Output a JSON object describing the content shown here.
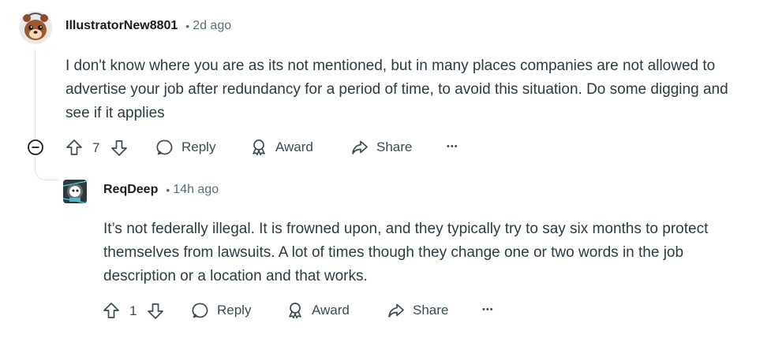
{
  "comments": [
    {
      "username": "IllustratorNew8801",
      "separator": "•",
      "time": "2d ago",
      "body": "I don't know where you are as its not mentioned, but in many places companies are not allowed to advertise your job after redundancy for a period of time, to avoid this situation. Do some digging and see if it applies",
      "votes": "7",
      "actions": {
        "reply": "Reply",
        "award": "Award",
        "share": "Share",
        "more": "•••"
      }
    },
    {
      "username": "ReqDeep",
      "separator": "•",
      "time": "14h ago",
      "body": "It’s not federally illegal. It is frowned upon, and they typically try to say six months to protect themselves from lawsuits. A lot of times though they change one or two words in the job description or a location and that works.",
      "votes": "1",
      "actions": {
        "reply": "Reply",
        "award": "Award",
        "share": "Share",
        "more": "•••"
      }
    }
  ]
}
